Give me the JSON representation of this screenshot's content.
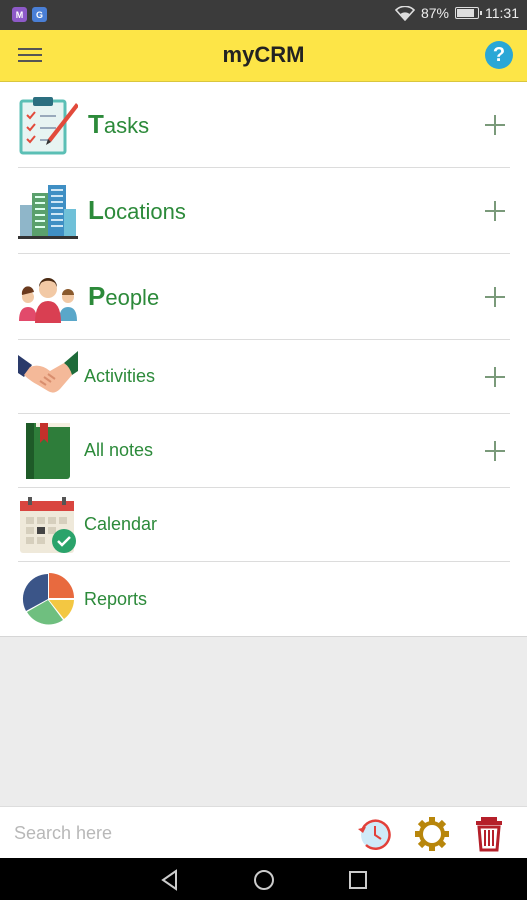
{
  "status_bar": {
    "app_badges": [
      "M",
      "G"
    ],
    "battery": "87%",
    "battery_level": 0.87,
    "time": "11:31"
  },
  "app_bar": {
    "title": "myCRM",
    "help_glyph": "?"
  },
  "menu": [
    {
      "initial": "T",
      "rest": "asks",
      "label": "Tasks",
      "icon": "clipboard-icon",
      "add": true
    },
    {
      "initial": "L",
      "rest": "ocations",
      "label": "Locations",
      "icon": "buildings-icon",
      "add": true
    },
    {
      "initial": "P",
      "rest": "eople",
      "label": "People",
      "icon": "people-icon",
      "add": true
    },
    {
      "label": "Activities",
      "icon": "handshake-icon",
      "add": true
    },
    {
      "label": "All notes",
      "icon": "notebook-icon",
      "add": true
    },
    {
      "label": "Calendar",
      "icon": "calendar-icon",
      "add": false
    },
    {
      "label": "Reports",
      "icon": "pie-chart-icon",
      "add": false
    }
  ],
  "bottom_bar": {
    "search_placeholder": "Search here",
    "tools": [
      "history-icon",
      "settings-icon",
      "trash-icon"
    ]
  },
  "colors": {
    "accent_yellow": "#fde547",
    "label_green": "#2c8a3a",
    "help_blue": "#2aa7d6",
    "trash_red": "#b5202a",
    "gear_gold": "#b8860b"
  }
}
